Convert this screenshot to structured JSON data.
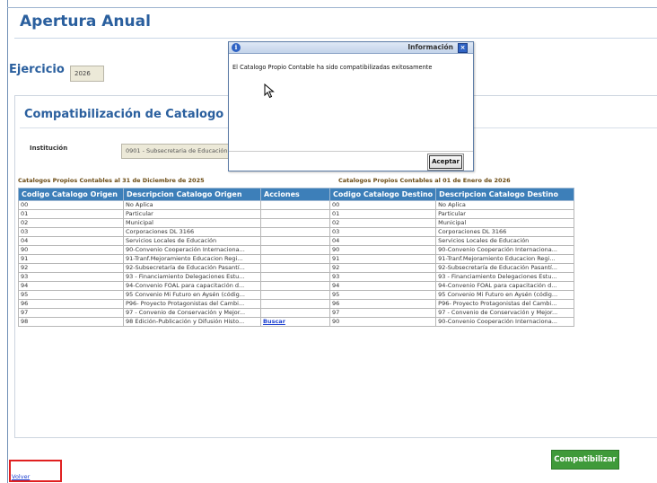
{
  "page": {
    "title": "Apertura Anual",
    "ejercicio_label": "Ejercicio",
    "ejercicio_value": "2026"
  },
  "panel": {
    "title": "Compatibilización de Catalogo Propio",
    "institucion_label": "Institución",
    "institucion_value": "0901 - Subsecretaria de Educación"
  },
  "captions": {
    "origen": "Catalogos Propios Contables al 31 de Diciembre de 2025",
    "destino": "Catalogos Propios Contables al 01 de Enero de 2026"
  },
  "table": {
    "headers": [
      "Codigo Catalogo Origen",
      "Descripcion Catalogo Origen",
      "Acciones",
      "Codigo Catalogo Destino",
      "Descripcion Catalogo Destino"
    ],
    "rows": [
      {
        "o_code": "00",
        "o_desc": "No Aplica",
        "action": "",
        "d_code": "00",
        "d_desc": "No Aplica"
      },
      {
        "o_code": "01",
        "o_desc": "Particular",
        "action": "",
        "d_code": "01",
        "d_desc": "Particular"
      },
      {
        "o_code": "02",
        "o_desc": "Municipal",
        "action": "",
        "d_code": "02",
        "d_desc": "Municipal"
      },
      {
        "o_code": "03",
        "o_desc": "Corporaciones DL 3166",
        "action": "",
        "d_code": "03",
        "d_desc": "Corporaciones DL 3166"
      },
      {
        "o_code": "04",
        "o_desc": "Servicios Locales de Educación",
        "action": "",
        "d_code": "04",
        "d_desc": "Servicios Locales de Educación"
      },
      {
        "o_code": "90",
        "o_desc": "90-Convenio Cooperación Internaciona...",
        "action": "",
        "d_code": "90",
        "d_desc": "90-Convenio Cooperación Internaciona..."
      },
      {
        "o_code": "91",
        "o_desc": "91-Tranf.Mejoramiento Educacion Regi...",
        "action": "",
        "d_code": "91",
        "d_desc": "91-Tranf.Mejoramiento Educacion Regi..."
      },
      {
        "o_code": "92",
        "o_desc": "92-Subsecretaría de Educación Pasantí...",
        "action": "",
        "d_code": "92",
        "d_desc": "92-Subsecretaría de Educación Pasantí..."
      },
      {
        "o_code": "93",
        "o_desc": "93 - Financiamiento Delegaciones Estu...",
        "action": "",
        "d_code": "93",
        "d_desc": "93 - Financiamiento Delegaciones Estu..."
      },
      {
        "o_code": "94",
        "o_desc": "94-Convenio FOAL para capacitación d...",
        "action": "",
        "d_code": "94",
        "d_desc": "94-Convenio FOAL para capacitación d..."
      },
      {
        "o_code": "95",
        "o_desc": "95 Convenio Mi Futuro en Aysén (códig...",
        "action": "",
        "d_code": "95",
        "d_desc": "95 Convenio Mi Futuro en Aysén (códig..."
      },
      {
        "o_code": "96",
        "o_desc": "P96- Proyecto Protagonistas del Cambi...",
        "action": "",
        "d_code": "96",
        "d_desc": "P96- Proyecto Protagonistas del Cambi..."
      },
      {
        "o_code": "97",
        "o_desc": "97 - Convenio de Conservación y Mejor...",
        "action": "",
        "d_code": "97",
        "d_desc": "97 - Convenio de Conservación y Mejor..."
      },
      {
        "o_code": "98",
        "o_desc": "98 Edición-Publicación y Difusión Histo...",
        "action": "Buscar",
        "d_code": "90",
        "d_desc": "90-Convenio Cooperación Internaciona..."
      }
    ]
  },
  "buttons": {
    "compatibilizar": "Compatibilizar",
    "volver": "Volver"
  },
  "modal": {
    "title": "Información",
    "message": "El Catalogo Propio Contable ha sido compatibilizadas exitosamente",
    "accept": "Aceptar",
    "icons": {
      "info": "info-icon",
      "close": "close-icon",
      "cursor": "mouse-pointer-icon"
    }
  },
  "colors": {
    "title": "#2a5f9e",
    "table_header": "#3d7fb9",
    "compat_button": "#3f9a3a",
    "highlight": "#e02020",
    "link": "#1b3fd0"
  }
}
